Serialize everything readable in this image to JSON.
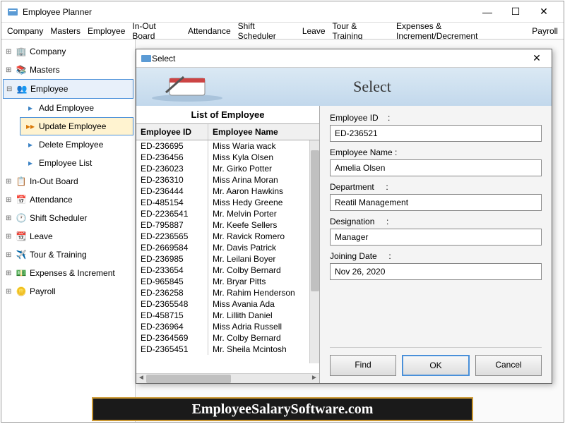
{
  "app": {
    "title": "Employee Planner"
  },
  "menubar": [
    "Company",
    "Masters",
    "Employee",
    "In-Out Board",
    "Attendance",
    "Shift Scheduler",
    "Leave",
    "Tour & Training",
    "Expenses & Increment/Decrement",
    "Payroll"
  ],
  "tree": {
    "company": "Company",
    "masters": "Masters",
    "employee": "Employee",
    "employee_sub": {
      "add": "Add Employee",
      "update": "Update Employee",
      "delete": "Delete Employee",
      "list": "Employee List"
    },
    "inout": "In-Out Board",
    "attendance": "Attendance",
    "shift": "Shift Scheduler",
    "leave": "Leave",
    "tour": "Tour & Training",
    "expenses": "Expenses & Increment",
    "payroll": "Payroll"
  },
  "dialog": {
    "title": "Select",
    "heading": "Select",
    "list_title": "List of Employee",
    "headers": {
      "id": "Employee ID",
      "name": "Employee Name"
    },
    "rows": [
      {
        "id": "ED-236695",
        "name": "Miss Waria wack"
      },
      {
        "id": "ED-236456",
        "name": "Miss Kyla Olsen"
      },
      {
        "id": "ED-236023",
        "name": "Mr. Girko Potter"
      },
      {
        "id": "ED-236310",
        "name": "Miss Arina Moran"
      },
      {
        "id": "ED-236444",
        "name": "Mr. Aaron Hawkins"
      },
      {
        "id": "ED-485154",
        "name": "Miss Hedy Greene"
      },
      {
        "id": "ED-2236541",
        "name": "Mr. Melvin Porter"
      },
      {
        "id": "ED-795887",
        "name": "Mr. Keefe Sellers"
      },
      {
        "id": "ED-2236565",
        "name": "Mr. Ravick Romero"
      },
      {
        "id": "ED-2669584",
        "name": "Mr. Davis Patrick"
      },
      {
        "id": "ED-236985",
        "name": "Mr. Leilani Boyer"
      },
      {
        "id": "ED-233654",
        "name": "Mr. Colby Bernard"
      },
      {
        "id": "ED-965845",
        "name": "Mr. Bryar Pitts"
      },
      {
        "id": "ED-236258",
        "name": "Mr. Rahim Henderson"
      },
      {
        "id": "ED-2365548",
        "name": "Miss Avania Ada"
      },
      {
        "id": "ED-458715",
        "name": "Mr. Lillith Daniel"
      },
      {
        "id": "ED-236964",
        "name": "Miss Adria Russell"
      },
      {
        "id": "ED-2364569",
        "name": "Mr. Colby Bernard"
      },
      {
        "id": "ED-2365451",
        "name": "Mr. Sheila Mcintosh"
      }
    ],
    "form": {
      "emp_id_label": "Employee ID",
      "emp_id": "ED-236521",
      "emp_name_label": "Employee Name :",
      "emp_name": "Amelia Olsen",
      "dept_label": "Department",
      "dept": "Reatil Management",
      "desig_label": "Designation",
      "desig": "Manager",
      "join_label": "Joining Date",
      "join": "Nov 26, 2020"
    },
    "buttons": {
      "find": "Find",
      "ok": "OK",
      "cancel": "Cancel"
    }
  },
  "watermark": "EmployeeSalarySoftware.com"
}
